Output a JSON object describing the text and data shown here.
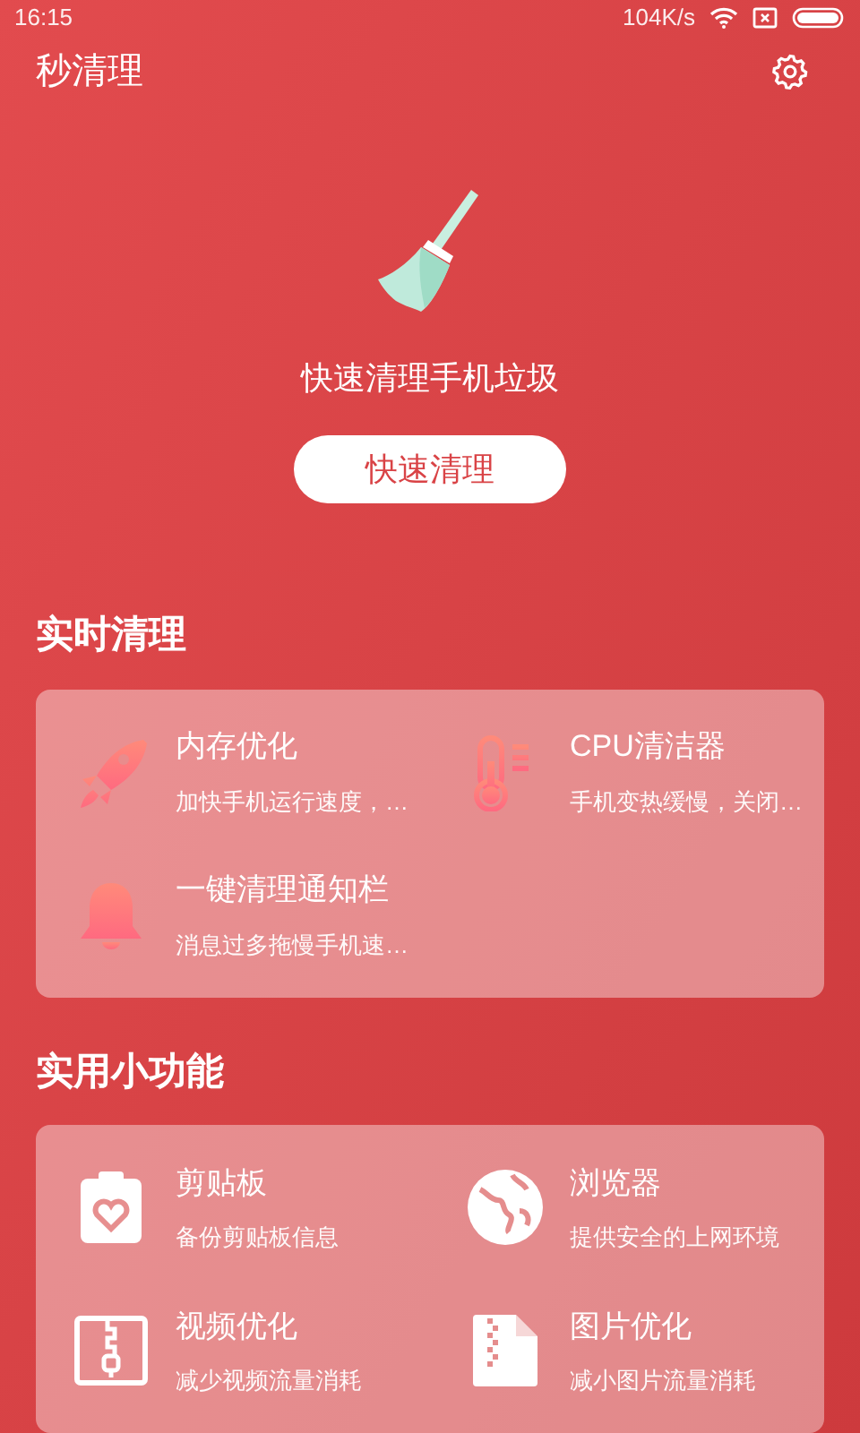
{
  "status_bar": {
    "time": "16:15",
    "speed": "104K/s"
  },
  "header": {
    "title": "秒清理"
  },
  "hero": {
    "caption": "快速清理手机垃圾",
    "button": "快速清理"
  },
  "sections": [
    {
      "title": "实时清理",
      "items": [
        {
          "kind": "rocket",
          "title": "内存优化",
          "subtitle": "加快手机运行速度，…"
        },
        {
          "kind": "thermometer",
          "title": "CPU清洁器",
          "subtitle": "手机变热缓慢，关闭…"
        },
        {
          "kind": "bell",
          "title": "一键清理通知栏",
          "subtitle": "消息过多拖慢手机速…"
        }
      ]
    },
    {
      "title": "实用小功能",
      "items": [
        {
          "kind": "clipboard",
          "title": "剪贴板",
          "subtitle": "备份剪贴板信息"
        },
        {
          "kind": "globe",
          "title": "浏览器",
          "subtitle": "提供安全的上网环境"
        },
        {
          "kind": "zipbox",
          "title": "视频优化",
          "subtitle": "减少视频流量消耗"
        },
        {
          "kind": "zipfile",
          "title": "图片优化",
          "subtitle": "减小图片流量消耗"
        }
      ]
    }
  ]
}
